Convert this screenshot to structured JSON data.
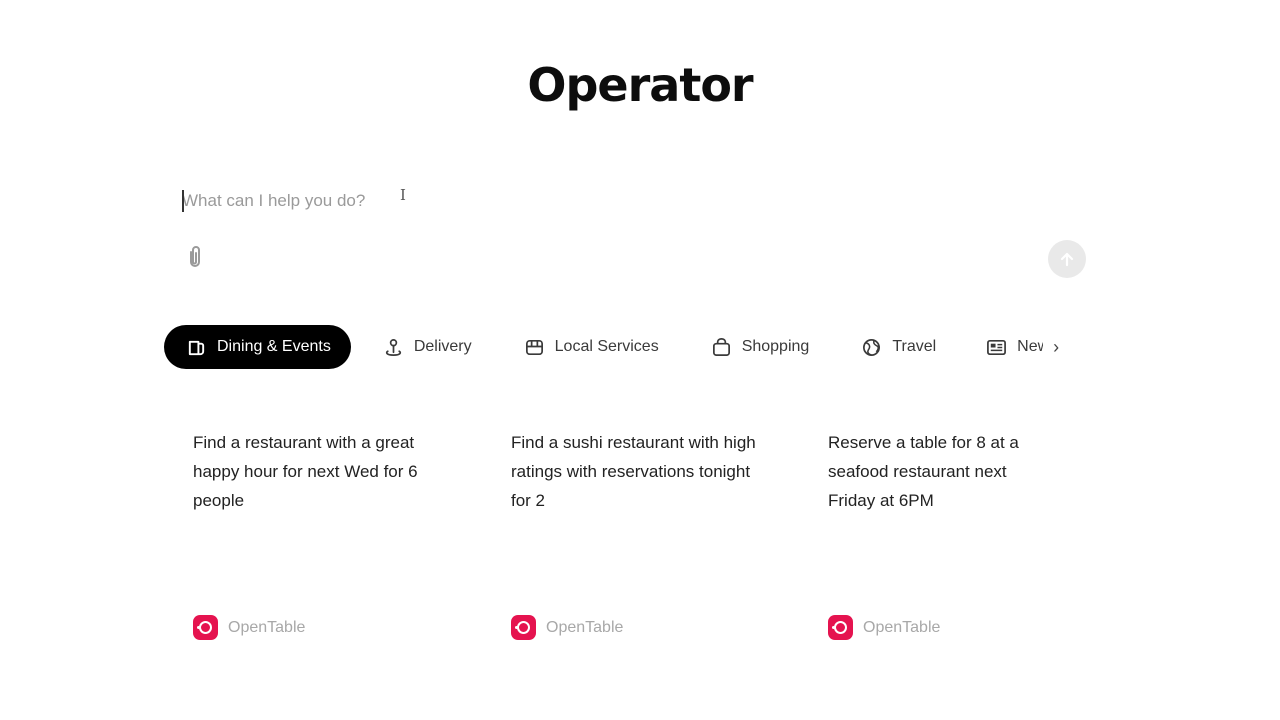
{
  "header": {
    "title": "Operator"
  },
  "composer": {
    "placeholder": "What can I help you do?",
    "value": "",
    "attach_icon": "paperclip-icon",
    "send_icon": "arrow-up-icon"
  },
  "tabs": [
    {
      "label": "Dining & Events",
      "icon": "dining-icon",
      "active": true
    },
    {
      "label": "Delivery",
      "icon": "location-pin-icon",
      "active": false
    },
    {
      "label": "Local Services",
      "icon": "storefront-icon",
      "active": false
    },
    {
      "label": "Shopping",
      "icon": "shopping-bag-icon",
      "active": false
    },
    {
      "label": "Travel",
      "icon": "globe-icon",
      "active": false
    },
    {
      "label": "News",
      "icon": "newspaper-icon",
      "active": false
    }
  ],
  "tabs_next_icon": "chevron-right-icon",
  "cards": [
    {
      "text": "Find a restaurant with a great happy hour for next Wed for 6 people",
      "source": "OpenTable"
    },
    {
      "text": "Find a sushi restaurant with high ratings with reservations tonight for 2",
      "source": "OpenTable"
    },
    {
      "text": "Reserve a table for 8 at a seafood restaurant next Friday at 6PM",
      "source": "OpenTable"
    }
  ],
  "colors": {
    "opentable_brand": "#e5134f",
    "active_tab_bg": "#000000",
    "send_disabled": "#e9e9e9"
  }
}
